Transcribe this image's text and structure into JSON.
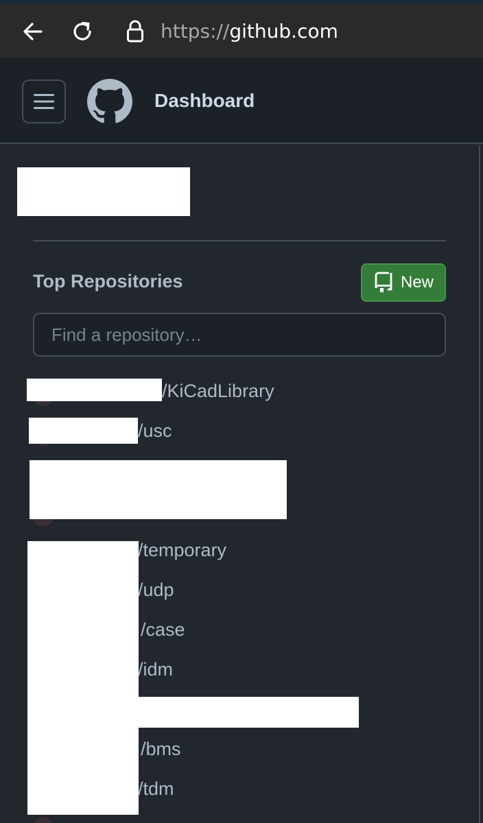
{
  "browser": {
    "url_scheme": "https://",
    "url_host": "github.com",
    "icons": [
      "back-arrow-icon",
      "reload-icon",
      "lock-icon"
    ]
  },
  "header": {
    "title": "Dashboard",
    "icons": [
      "hamburger-menu-icon",
      "github-logo-icon"
    ]
  },
  "sidebar": {
    "section_title": "Top Repositories",
    "new_button_label": "New",
    "new_button_icon": "repo-icon",
    "search_placeholder": "Find a repository…",
    "repos": [
      {
        "visible_text": "/KiCadLibrary"
      },
      {
        "visible_text": "/usc"
      },
      {
        "visible_text": "/temporary"
      },
      {
        "visible_text": "/udp"
      },
      {
        "visible_text": "/case"
      },
      {
        "visible_text": "/idm"
      },
      {
        "visible_text": "/bms"
      },
      {
        "visible_text": "/tdm"
      }
    ]
  },
  "colors": {
    "background": "#22272e",
    "header_background": "#1c2128",
    "urlbar_background": "#2b2a29",
    "primary_button": "#347d39",
    "text": "#adbac7",
    "border": "#444c56"
  }
}
